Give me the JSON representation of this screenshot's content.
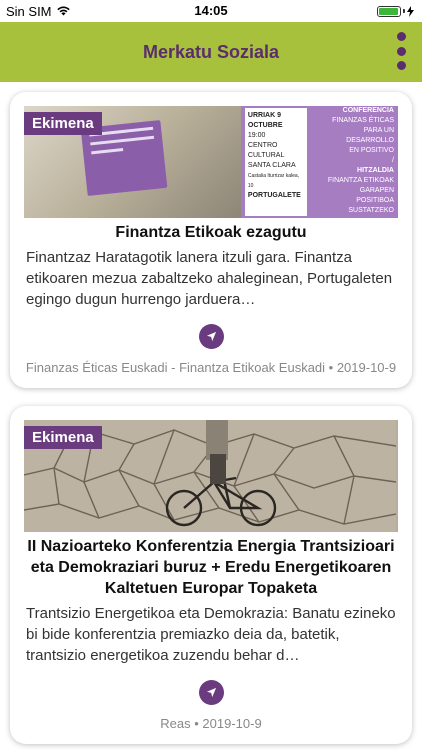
{
  "status_bar": {
    "carrier": "Sin SIM",
    "time": "14:05",
    "battery_level": 0.95
  },
  "header": {
    "title": "Merkatu Soziala"
  },
  "colors": {
    "header_bg": "#a7c13d",
    "accent_purple": "#5b2d6e",
    "badge_purple": "#6a3b7e"
  },
  "cards": [
    {
      "badge": "Ekimena",
      "image_icon": "event-poster-image",
      "poster_text": {
        "left_lines": [
          "URRIAK 9 OCTUBRE",
          "19:00",
          "CENTRO CULTURAL",
          "SANTA CLARA",
          "Castalia Iturrizar kalea, 10",
          "PORTUGALETE"
        ],
        "right_lines": [
          "CONFERENCIA",
          "FINANZAS ÉTICAS",
          "PARA UN DESARROLLO",
          "EN POSITIVO",
          "/",
          "HITZALDIA",
          "FINANTZA ETIKOAK",
          "GARAPEN POSITIBOA",
          "SUSTATZEKO"
        ]
      },
      "title": "Finantza Etikoak ezagutu",
      "description": "Finantzaz Haratagotik lanera itzuli gara. Finantza etikoaren mezua zabaltzeko ahaleginean, Portugaleten egingo dugun hurrengo jarduera…",
      "meta": "Finanzas Éticas Euskadi - Finantza Etikoak Euskadi • 2019-10-9"
    },
    {
      "badge": "Ekimena",
      "image_icon": "cracked-earth-cyclist-image",
      "title": "II Nazioarteko Konferentzia Energia Trantsizioari eta Demokraziari buruz + Eredu Energetikoaren Kaltetuen Europar Topaketa",
      "description": "Trantsizio Energetikoa eta Demokrazia: Banatu ezineko bi bide konferentzia premiazko deia da, batetik, trantsizio energetikoa zuzendu behar d…",
      "meta": "Reas • 2019-10-9"
    }
  ]
}
